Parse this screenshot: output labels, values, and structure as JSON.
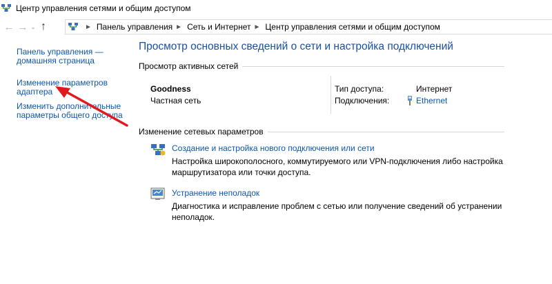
{
  "window": {
    "title": "Центр управления сетями и общим доступом"
  },
  "nav": {
    "breadcrumbs": [
      "Панель управления",
      "Сеть и Интернет",
      "Центр управления сетями и общим доступом"
    ]
  },
  "sidebar": {
    "home_line1": "Панель управления —",
    "home_line2": "домашняя страница",
    "adapter_line1": "Изменение параметров",
    "adapter_line2": "адаптера",
    "sharing_line1": "Изменить дополнительные",
    "sharing_line2": "параметры общего доступа"
  },
  "main": {
    "title": "Просмотр основных сведений о сети и настройка подключений",
    "active_networks_header": "Просмотр активных сетей",
    "network": {
      "name": "Goodness",
      "type": "Частная сеть",
      "access_label": "Тип доступа:",
      "access_value": "Интернет",
      "connections_label": "Подключения:",
      "connections_value": "Ethernet"
    },
    "change_settings_header": "Изменение сетевых параметров",
    "tasks": [
      {
        "title": "Создание и настройка нового подключения или сети",
        "desc_line1": "Настройка широкополосного, коммутируемого или VPN-подключения либо настройка",
        "desc_line2": "маршрутизатора или точки доступа."
      },
      {
        "title": "Устранение неполадок",
        "desc_line1": "Диагностика и исправление проблем с сетью или получение сведений об устранении",
        "desc_line2": "неполадок."
      }
    ]
  },
  "colors": {
    "link": "#0c56ad",
    "title": "#1a4fa3",
    "arrow": "#e0191f"
  }
}
